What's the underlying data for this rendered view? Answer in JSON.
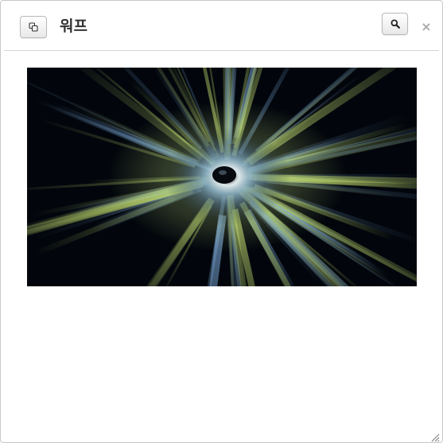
{
  "window": {
    "title": "워프"
  },
  "header": {
    "copy_icon": "copy-icon",
    "search_icon": "search-icon",
    "close_label": "×"
  },
  "image": {
    "subject": "warp-tunnel-light-burst",
    "colors": {
      "background": "#02060c",
      "green": "#b6cf6a",
      "blue": "#6f9fd0",
      "light": "#e9f2f6"
    }
  },
  "resize_icon": "resize-grip-icon"
}
